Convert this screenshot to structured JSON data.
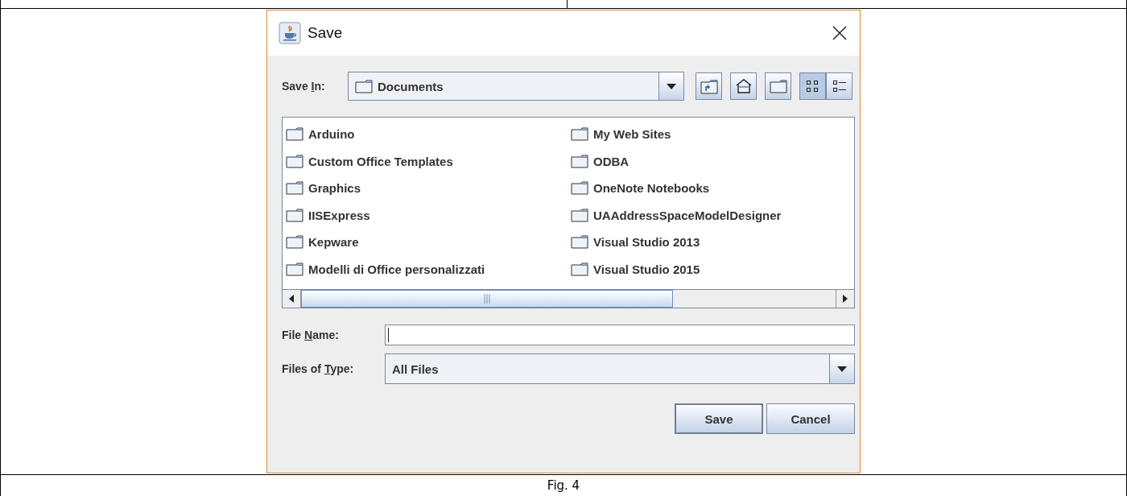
{
  "dialog": {
    "title": "Save",
    "save_in": {
      "label": {
        "before": "Save ",
        "key": "I",
        "after": "n:"
      },
      "value": "Documents"
    },
    "view_buttons": [
      {
        "kind": "list",
        "selected": true
      },
      {
        "kind": "details",
        "selected": false
      }
    ],
    "files": [
      "Arduino",
      "Custom Office Templates",
      "Graphics",
      "IISExpress",
      "Kepware",
      "Modelli di Office personalizzati",
      "My Web Sites",
      "ODBA",
      "OneNote Notebooks",
      "UAAddressSpaceModelDesigner",
      "Visual Studio 2013",
      "Visual Studio 2015"
    ],
    "file_name": {
      "label": {
        "before": "File ",
        "key": "N",
        "after": "ame:"
      }
    },
    "file_type": {
      "label": {
        "before": "Files of ",
        "key": "T",
        "after": "ype:"
      },
      "value": "All Files"
    },
    "buttons": [
      {
        "label": "Save",
        "default": true
      },
      {
        "label": "Cancel",
        "default": false
      }
    ]
  },
  "caption": "Fig. 4"
}
